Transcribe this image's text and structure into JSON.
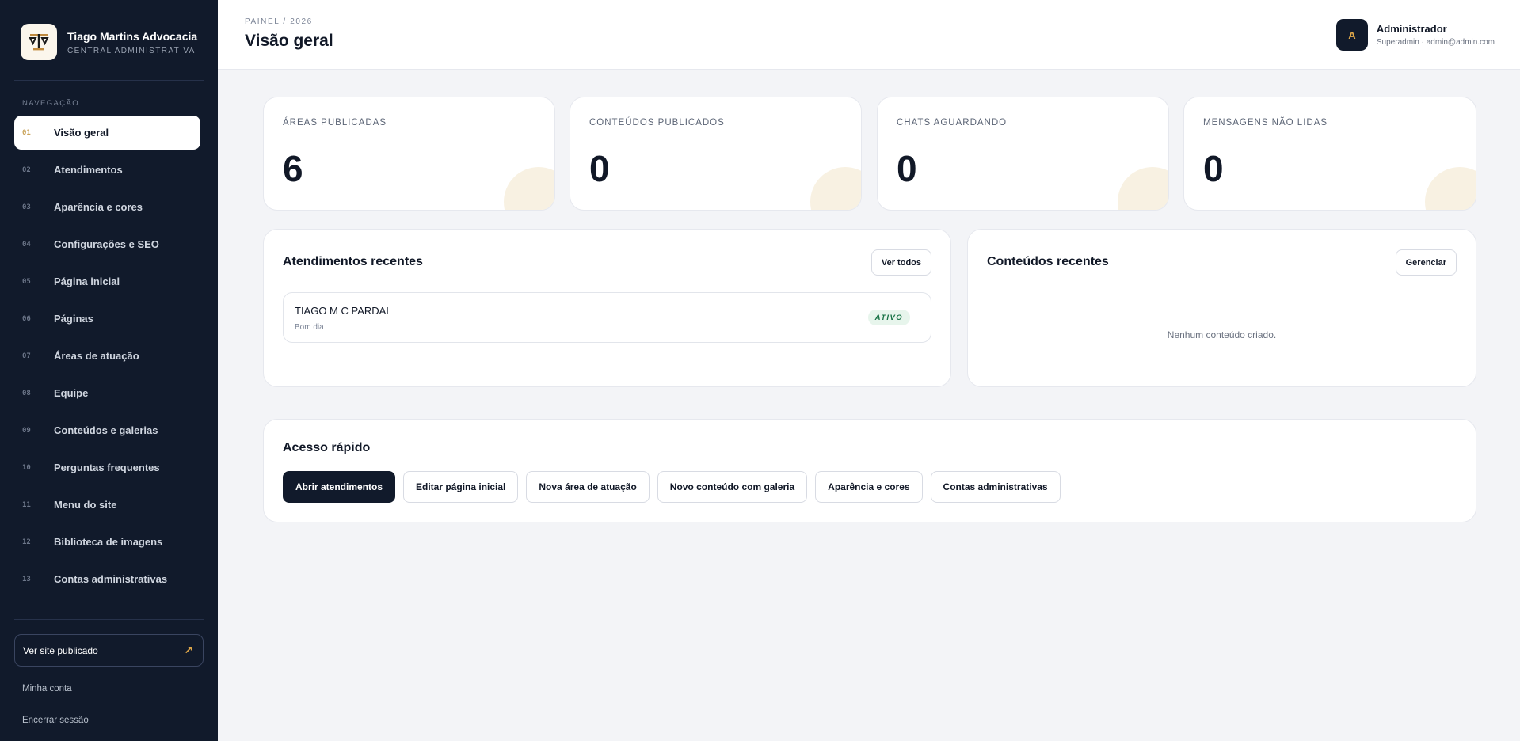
{
  "brand": {
    "name": "Tiago Martins Advocacia",
    "subtitle": "CENTRAL ADMINISTRATIVA"
  },
  "nav": {
    "heading": "NAVEGAÇÃO",
    "items": [
      {
        "num": "01",
        "label": "Visão geral"
      },
      {
        "num": "02",
        "label": "Atendimentos"
      },
      {
        "num": "03",
        "label": "Aparência e cores"
      },
      {
        "num": "04",
        "label": "Configurações e SEO"
      },
      {
        "num": "05",
        "label": "Página inicial"
      },
      {
        "num": "06",
        "label": "Páginas"
      },
      {
        "num": "07",
        "label": "Áreas de atuação"
      },
      {
        "num": "08",
        "label": "Equipe"
      },
      {
        "num": "09",
        "label": "Conteúdos e galerias"
      },
      {
        "num": "10",
        "label": "Perguntas frequentes"
      },
      {
        "num": "11",
        "label": "Menu do site"
      },
      {
        "num": "12",
        "label": "Biblioteca de imagens"
      },
      {
        "num": "13",
        "label": "Contas administrativas"
      }
    ],
    "active_index": 0
  },
  "sidebar_footer": {
    "site_button": "Ver site publicado",
    "site_button_icon": "arrow-up-right-icon",
    "my_account": "Minha conta",
    "logout": "Encerrar sessão"
  },
  "header": {
    "breadcrumb": "PAINEL / 2026",
    "title": "Visão geral"
  },
  "user": {
    "initial": "A",
    "name": "Administrador",
    "meta": "Superadmin · admin@admin.com"
  },
  "stats": [
    {
      "label": "ÁREAS PUBLICADAS",
      "value": "6"
    },
    {
      "label": "CONTEÚDOS PUBLICADOS",
      "value": "0"
    },
    {
      "label": "CHATS AGUARDANDO",
      "value": "0"
    },
    {
      "label": "MENSAGENS NÃO LIDAS",
      "value": "0"
    }
  ],
  "recent_tickets": {
    "title": "Atendimentos recentes",
    "button": "Ver todos",
    "items": [
      {
        "name": "TIAGO M C PARDAL",
        "subtitle": "Bom dia",
        "status": "ATIVO"
      }
    ]
  },
  "recent_contents": {
    "title": "Conteúdos recentes",
    "button": "Gerenciar",
    "empty": "Nenhum conteúdo criado."
  },
  "quick_access": {
    "title": "Acesso rápido",
    "buttons": [
      "Abrir atendimentos",
      "Editar página inicial",
      "Nova área de atuação",
      "Novo conteúdo com galeria",
      "Aparência e cores",
      "Contas administrativas"
    ]
  },
  "colors": {
    "sidebar_bg": "#111a2b",
    "accent_gold": "#c9a35a",
    "status_green": "#177245"
  }
}
